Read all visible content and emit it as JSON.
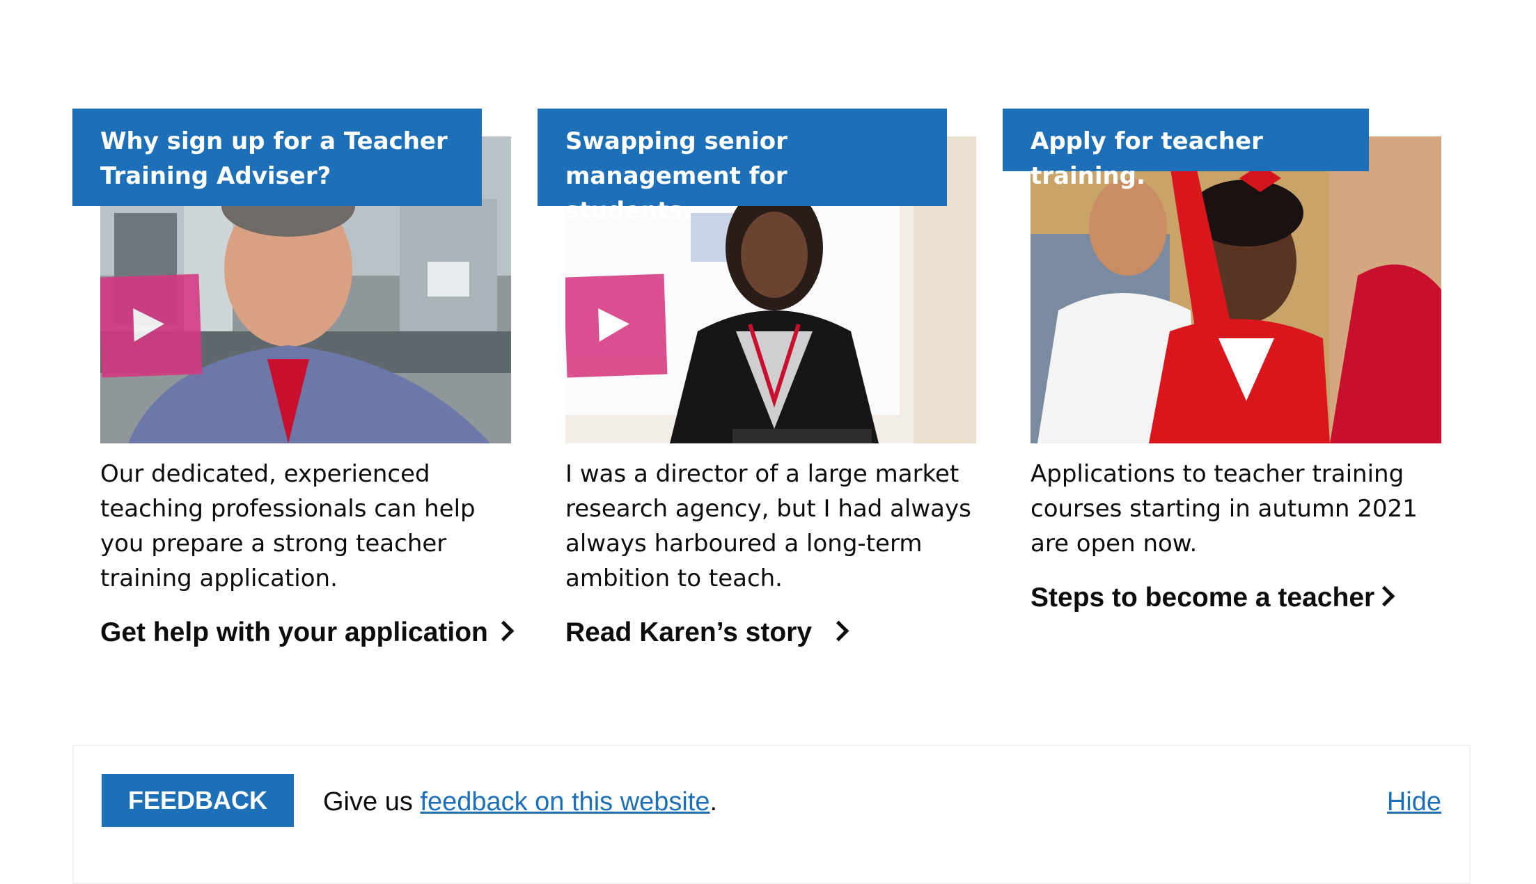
{
  "cards": [
    {
      "heading": "Why sign up for a Teacher Training Adviser?",
      "media_type": "video",
      "play_icon": "play-icon",
      "body": "Our dedicated, experienced teaching professionals can help you prepare a strong teacher training application.",
      "link_text": "Get help with your application"
    },
    {
      "heading": "Swapping senior management for students.",
      "media_type": "video",
      "play_icon": "play-icon",
      "body": "I was a director of a large market research agency, but I had always always harboured a long-term ambition to teach.",
      "link_text": "Read Karen’s story"
    },
    {
      "heading": "Apply for teacher training.",
      "media_type": "image",
      "body": "Applications to teacher training courses starting in autumn 2021 are open now.",
      "link_text": "Steps to become a teacher"
    }
  ],
  "feedback": {
    "tag": "FEEDBACK",
    "prefix": "Give us ",
    "link_text": "feedback on this website",
    "suffix": ".",
    "hide": "Hide"
  },
  "colors": {
    "brand_blue": "#1d70b8",
    "play_pink": "#d53880",
    "text": "#0b0c0c"
  }
}
